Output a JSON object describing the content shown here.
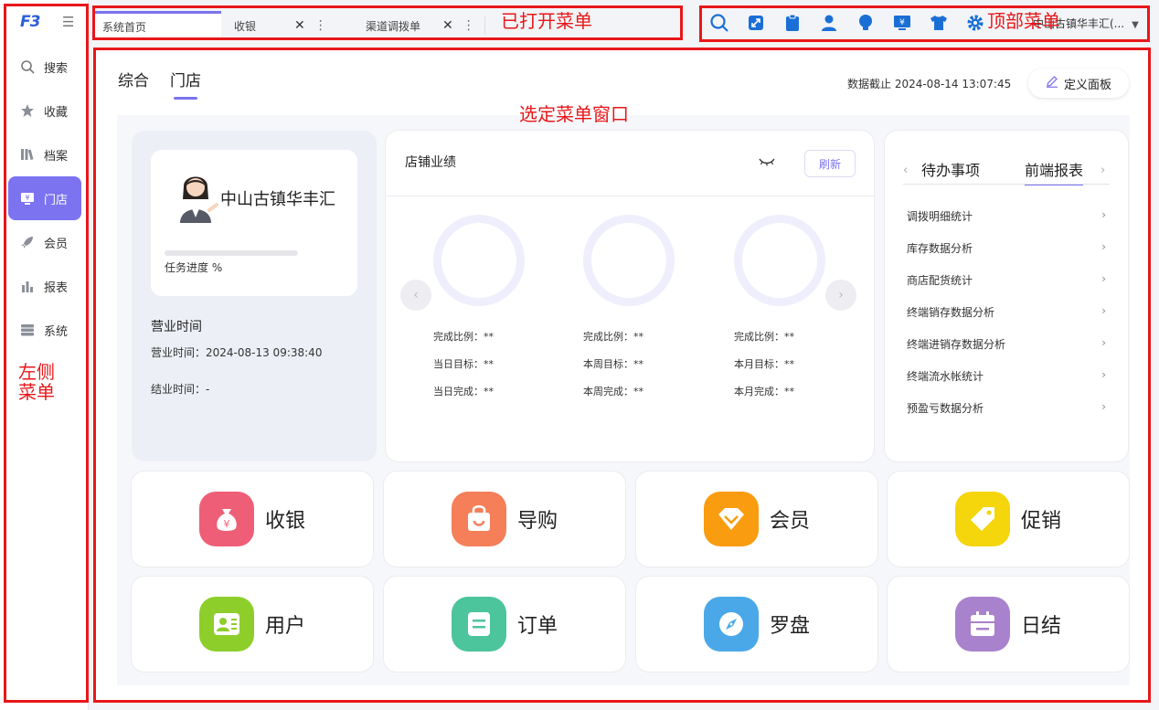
{
  "sidebar": {
    "logo": "F3",
    "items": [
      {
        "label": "搜索",
        "icon": "search-icon"
      },
      {
        "label": "收藏",
        "icon": "star-icon"
      },
      {
        "label": "档案",
        "icon": "books-icon"
      },
      {
        "label": "门店",
        "icon": "store-icon",
        "active": true
      },
      {
        "label": "会员",
        "icon": "rocket-icon"
      },
      {
        "label": "报表",
        "icon": "bar-chart-icon"
      },
      {
        "label": "系统",
        "icon": "server-icon"
      }
    ]
  },
  "tabs": {
    "items": [
      {
        "label": "系统首页"
      },
      {
        "label": "收银"
      },
      {
        "label": "渠道调拨单"
      }
    ]
  },
  "topbar": {
    "icons": [
      "search-icon",
      "fullscreen-icon",
      "clipboard-icon",
      "user-icon",
      "bulb-icon",
      "cashier-icon",
      "shirt-icon",
      "gear-icon"
    ],
    "store_selector": "中山古镇华丰汇(..."
  },
  "main": {
    "tabs": [
      {
        "label": "综合"
      },
      {
        "label": "门店",
        "active": true
      }
    ],
    "cutoff": "数据截止 2024-08-14 13:07:45",
    "define_panel": "定义面板"
  },
  "store": {
    "name": "中山古镇华丰汇",
    "progress_label": "任务进度 %",
    "hours_title": "营业时间",
    "open_time": "营业时间：2024-08-13 09:38:40",
    "close_time": "结业时间：-"
  },
  "performance": {
    "title": "店铺业绩",
    "refresh": "刷新",
    "columns": [
      {
        "ratio": "完成比例：**",
        "target": "当日目标：**",
        "done": "当日完成：**"
      },
      {
        "ratio": "完成比例：**",
        "target": "本周目标：**",
        "done": "本周完成：**"
      },
      {
        "ratio": "完成比例：**",
        "target": "本月目标：**",
        "done": "本月完成：**"
      }
    ]
  },
  "reports": {
    "tabs": [
      {
        "label": "待办事项"
      },
      {
        "label": "前端报表",
        "active": true
      }
    ],
    "items": [
      {
        "label": "调拨明细统计"
      },
      {
        "label": "库存数据分析"
      },
      {
        "label": "商店配货统计"
      },
      {
        "label": "终端销存数据分析"
      },
      {
        "label": "终端进销存数据分析"
      },
      {
        "label": "终端流水帐统计"
      },
      {
        "label": "预盈亏数据分析"
      }
    ]
  },
  "tiles": [
    {
      "label": "收银",
      "icon": "money-bag-icon",
      "color": "#ee5f77"
    },
    {
      "label": "导购",
      "icon": "shopping-bag-icon",
      "color": "#f47f59"
    },
    {
      "label": "会员",
      "icon": "diamond-icon",
      "color": "#f99c0f"
    },
    {
      "label": "促销",
      "icon": "tag-icon",
      "color": "#f5d50b"
    },
    {
      "label": "用户",
      "icon": "user-card-icon",
      "color": "#8ece2b"
    },
    {
      "label": "订单",
      "icon": "order-icon",
      "color": "#4cc49c"
    },
    {
      "label": "罗盘",
      "icon": "compass-icon",
      "color": "#4aa8e8"
    },
    {
      "label": "日结",
      "icon": "calendar-icon",
      "color": "#a882cc"
    }
  ],
  "annotations": {
    "tabs": "已打开菜单",
    "topbar": "顶部菜单",
    "main": "选定菜单窗口",
    "sidebar_line1": "左侧",
    "sidebar_line2": "菜单"
  }
}
